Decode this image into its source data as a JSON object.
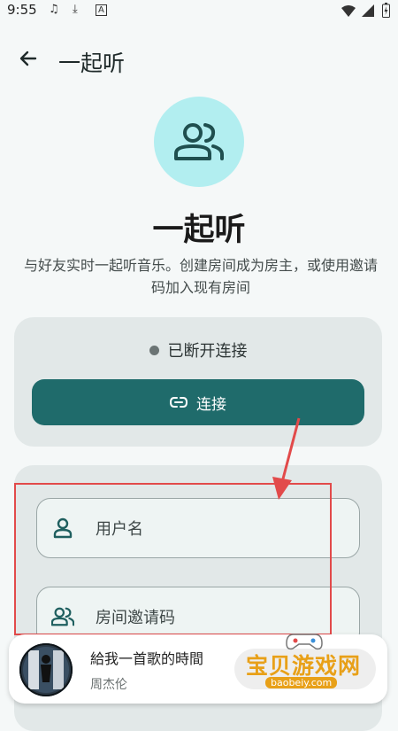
{
  "status_bar": {
    "time": "9:55",
    "left_icons": [
      "music-note-icon",
      "download-icon",
      "text-a-icon"
    ],
    "right_icons": [
      "wifi-icon",
      "signal-icon",
      "battery-icon"
    ]
  },
  "app_bar": {
    "title": "一起听"
  },
  "hero": {
    "title": "一起听",
    "description": "与好友实时一起听音乐。创建房间成为房主，或使用邀请码加入现有房间"
  },
  "connection": {
    "status": "已断开连接",
    "button_label": "连接"
  },
  "form": {
    "username_label": "用户名",
    "invite_code_label": "房间邀请码"
  },
  "player": {
    "song_title": "給我一首歌的時間",
    "artist": "周杰伦"
  },
  "watermark": {
    "text": "宝贝游戏网",
    "url": "baobeiy.com"
  },
  "colors": {
    "primary": "#1f6b6b",
    "hero_circle": "#b2eef0",
    "card_background": "#e2e8e8",
    "annotation": "#e24a4a",
    "watermark": "#e8a018"
  }
}
